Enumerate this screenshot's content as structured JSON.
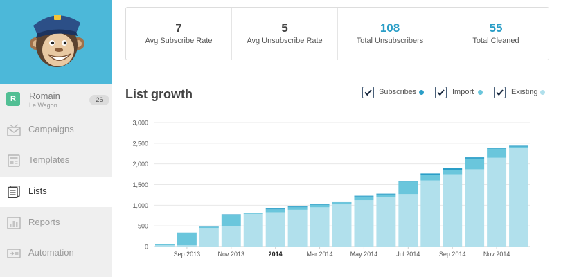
{
  "sidebar": {
    "user": {
      "initial": "R",
      "name": "Romain",
      "org": "Le Wagon",
      "count": "26"
    },
    "items": [
      {
        "label": "Campaigns",
        "icon": "campaigns-icon"
      },
      {
        "label": "Templates",
        "icon": "templates-icon"
      },
      {
        "label": "Lists",
        "icon": "lists-icon",
        "active": true
      },
      {
        "label": "Reports",
        "icon": "reports-icon"
      },
      {
        "label": "Automation",
        "icon": "automation-icon"
      }
    ]
  },
  "stats": [
    {
      "value": "7",
      "label": "Avg Subscribe Rate"
    },
    {
      "value": "5",
      "label": "Avg Unsubscribe Rate"
    },
    {
      "value": "108",
      "label": "Total Unsubscribers"
    },
    {
      "value": "55",
      "label": "Total Cleaned"
    }
  ],
  "section_title": "List growth",
  "legend": [
    {
      "label": "Subscribes",
      "checked": true,
      "color": "#2a9ec7"
    },
    {
      "label": "Import",
      "checked": true,
      "color": "#6ac6dc"
    },
    {
      "label": "Existing",
      "checked": true,
      "color": "#b1e0ec"
    }
  ],
  "colors": {
    "brand": "#4cb8d9",
    "accent": "#2a9ec7"
  },
  "chart_data": {
    "type": "bar",
    "stacked": true,
    "ylim": [
      0,
      3000
    ],
    "yticks": [
      "0",
      "500",
      "1,000",
      "1,500",
      "2,000",
      "2,500",
      "3,000"
    ],
    "xlabels": [
      {
        "text": "Sep 2013",
        "index": 1
      },
      {
        "text": "Nov 2013",
        "index": 3
      },
      {
        "text": "2014",
        "index": 5,
        "bold": true
      },
      {
        "text": "Mar 2014",
        "index": 7
      },
      {
        "text": "May 2014",
        "index": 9
      },
      {
        "text": "Jul 2014",
        "index": 11
      },
      {
        "text": "Sep 2014",
        "index": 13
      },
      {
        "text": "Nov 2014",
        "index": 15
      }
    ],
    "grid": true,
    "series": [
      {
        "name": "Existing",
        "color": "#b1e0ec",
        "values": [
          30,
          30,
          450,
          500,
          790,
          830,
          890,
          950,
          1020,
          1120,
          1200,
          1270,
          1600,
          1750,
          1870,
          2150,
          2380
        ]
      },
      {
        "name": "Import",
        "color": "#6ac6dc",
        "values": [
          20,
          310,
          20,
          270,
          20,
          70,
          60,
          60,
          50,
          90,
          60,
          300,
          130,
          110,
          260,
          220,
          40
        ]
      },
      {
        "name": "Subscribes",
        "color": "#2a9ec7",
        "values": [
          0,
          0,
          10,
          10,
          10,
          20,
          20,
          20,
          20,
          20,
          20,
          20,
          40,
          40,
          30,
          20,
          20
        ]
      }
    ]
  }
}
